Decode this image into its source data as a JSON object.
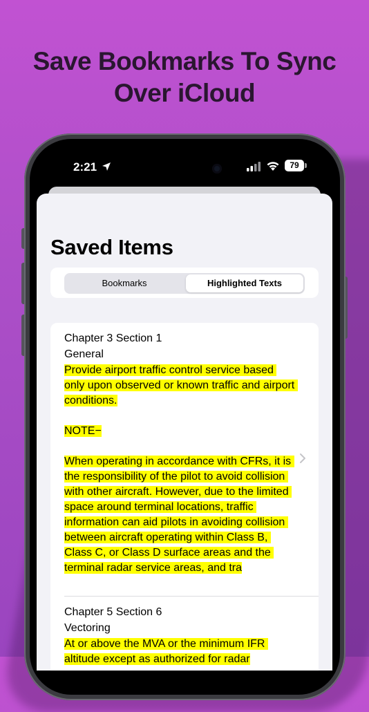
{
  "headline": {
    "line1": "Save Bookmarks To Sync",
    "line2": "Over iCloud"
  },
  "status_bar": {
    "time": "2:21",
    "battery": "79",
    "icons": [
      "location-arrow-icon",
      "signal-icon",
      "wifi-icon",
      "battery-icon"
    ]
  },
  "page": {
    "title": "Saved Items"
  },
  "segmented": {
    "options": [
      "Bookmarks",
      "Highlighted Texts"
    ],
    "selected": "Highlighted Texts"
  },
  "items": [
    {
      "title": "Chapter 3 Section 1",
      "subtitle": "General",
      "text": "Provide airport traffic control service based only upon observed or known traffic and airport conditions.\n\nNOTE−\n\nWhen operating in accordance with CFRs, it is the responsibility of the pilot to avoid collision with other aircraft. However, due to the limited space around terminal locations, traffic information can aid pilots in avoiding collision between aircraft operating within Class B, Class C, or Class D surface areas and the terminal radar service areas, and tra"
    },
    {
      "title": "Chapter 5 Section 6",
      "subtitle": "Vectoring",
      "text": "At or above the MVA or the minimum IFR altitude except as authorized for radar"
    }
  ],
  "colors": {
    "highlight": "#ffff00",
    "background_top": "#c152d2",
    "background_bottom": "#9a45bf",
    "headline": "#2a1630"
  }
}
